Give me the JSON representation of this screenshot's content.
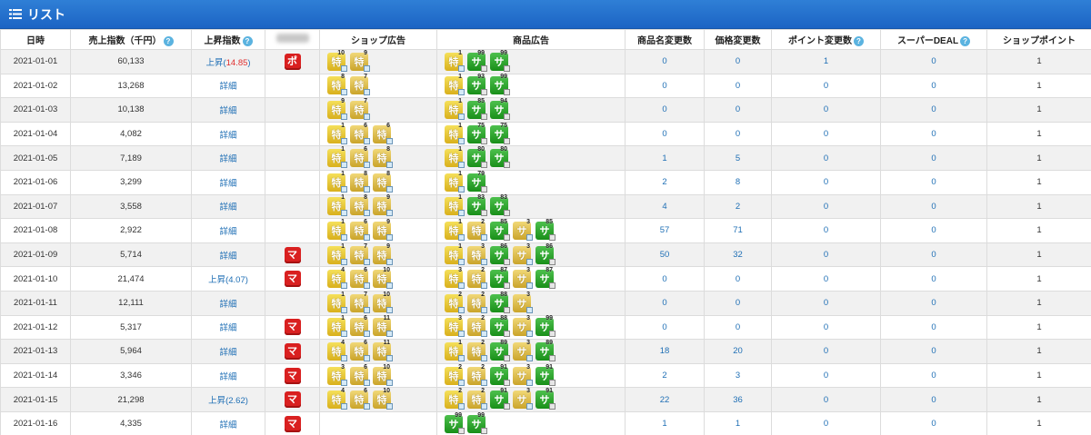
{
  "title": "リスト",
  "headers": {
    "date": "日時",
    "sales": "売上指数（千円）",
    "rise": "上昇指数",
    "shop_ad": "ショップ広告",
    "item_ad": "商品広告",
    "name_change": "商品名変更数",
    "price_change": "価格変更数",
    "point_change": "ポイント変更数",
    "super_deal": "スーパーDEAL",
    "shop_point": "ショップポイント"
  },
  "help_glyph": "?",
  "rows": [
    {
      "date": "2021-01-01",
      "sales": "60,133",
      "rise_prefix": "上昇(",
      "rise_value": "14.85",
      "rise_suffix": ")",
      "rise_type": "up-red",
      "badge": "ポ",
      "shop": [
        {
          "l": "特",
          "n": "10",
          "s": "y1"
        },
        {
          "l": "特",
          "n": "9",
          "s": "y2"
        }
      ],
      "item": [
        {
          "l": "特",
          "n": "1",
          "s": "y1"
        },
        {
          "l": "サ",
          "n": "99",
          "s": "g"
        },
        {
          "l": "サ",
          "n": "99",
          "s": "g"
        }
      ],
      "name": "0",
      "price": "0",
      "point": "1",
      "deal": "0",
      "sp": "1"
    },
    {
      "date": "2021-01-02",
      "sales": "13,268",
      "rise": "詳細",
      "badge": "",
      "shop": [
        {
          "l": "特",
          "n": "8",
          "s": "y1"
        },
        {
          "l": "特",
          "n": "7",
          "s": "y2"
        }
      ],
      "item": [
        {
          "l": "特",
          "n": "1",
          "s": "y1"
        },
        {
          "l": "サ",
          "n": "93",
          "s": "g"
        },
        {
          "l": "サ",
          "n": "99",
          "s": "g"
        }
      ],
      "name": "0",
      "price": "0",
      "point": "0",
      "deal": "0",
      "sp": "1"
    },
    {
      "date": "2021-01-03",
      "sales": "10,138",
      "rise": "詳細",
      "badge": "",
      "shop": [
        {
          "l": "特",
          "n": "9",
          "s": "y1"
        },
        {
          "l": "特",
          "n": "7",
          "s": "y2"
        }
      ],
      "item": [
        {
          "l": "特",
          "n": "1",
          "s": "y1"
        },
        {
          "l": "サ",
          "n": "85",
          "s": "g"
        },
        {
          "l": "サ",
          "n": "94",
          "s": "g"
        }
      ],
      "name": "0",
      "price": "0",
      "point": "0",
      "deal": "0",
      "sp": "1"
    },
    {
      "date": "2021-01-04",
      "sales": "4,082",
      "rise": "詳細",
      "badge": "",
      "shop": [
        {
          "l": "特",
          "n": "1",
          "s": "y1"
        },
        {
          "l": "特",
          "n": "6",
          "s": "y2"
        },
        {
          "l": "特",
          "n": "6",
          "s": "y2"
        }
      ],
      "item": [
        {
          "l": "特",
          "n": "1",
          "s": "y1"
        },
        {
          "l": "サ",
          "n": "75",
          "s": "g"
        },
        {
          "l": "サ",
          "n": "75",
          "s": "g"
        }
      ],
      "name": "0",
      "price": "0",
      "point": "0",
      "deal": "0",
      "sp": "1"
    },
    {
      "date": "2021-01-05",
      "sales": "7,189",
      "rise": "詳細",
      "badge": "",
      "shop": [
        {
          "l": "特",
          "n": "1",
          "s": "y1"
        },
        {
          "l": "特",
          "n": "6",
          "s": "y2"
        },
        {
          "l": "特",
          "n": "8",
          "s": "y2"
        }
      ],
      "item": [
        {
          "l": "特",
          "n": "1",
          "s": "y1"
        },
        {
          "l": "サ",
          "n": "80",
          "s": "g"
        },
        {
          "l": "サ",
          "n": "80",
          "s": "g"
        }
      ],
      "name": "1",
      "price": "5",
      "point": "0",
      "deal": "0",
      "sp": "1"
    },
    {
      "date": "2021-01-06",
      "sales": "3,299",
      "rise": "詳細",
      "badge": "",
      "shop": [
        {
          "l": "特",
          "n": "1",
          "s": "y1"
        },
        {
          "l": "特",
          "n": "8",
          "s": "y2"
        },
        {
          "l": "特",
          "n": "8",
          "s": "y2"
        }
      ],
      "item": [
        {
          "l": "特",
          "n": "1",
          "s": "y1"
        },
        {
          "l": "サ",
          "n": "79",
          "s": "g"
        }
      ],
      "name": "2",
      "price": "8",
      "point": "0",
      "deal": "0",
      "sp": "1"
    },
    {
      "date": "2021-01-07",
      "sales": "3,558",
      "rise": "詳細",
      "badge": "",
      "shop": [
        {
          "l": "特",
          "n": "1",
          "s": "y1"
        },
        {
          "l": "特",
          "n": "8",
          "s": "y2"
        },
        {
          "l": "特",
          "n": "9",
          "s": "y2"
        }
      ],
      "item": [
        {
          "l": "特",
          "n": "1",
          "s": "y1"
        },
        {
          "l": "サ",
          "n": "83",
          "s": "g"
        },
        {
          "l": "サ",
          "n": "83",
          "s": "g"
        }
      ],
      "name": "4",
      "price": "2",
      "point": "0",
      "deal": "0",
      "sp": "1"
    },
    {
      "date": "2021-01-08",
      "sales": "2,922",
      "rise": "詳細",
      "badge": "",
      "shop": [
        {
          "l": "特",
          "n": "1",
          "s": "y1"
        },
        {
          "l": "特",
          "n": "6",
          "s": "y2"
        },
        {
          "l": "特",
          "n": "9",
          "s": "y2"
        }
      ],
      "item": [
        {
          "l": "特",
          "n": "1",
          "s": "y1"
        },
        {
          "l": "特",
          "n": "2",
          "s": "y2"
        },
        {
          "l": "サ",
          "n": "85",
          "s": "g"
        },
        {
          "l": "サ",
          "n": "3",
          "s": "y2"
        },
        {
          "l": "サ",
          "n": "85",
          "s": "g"
        }
      ],
      "name": "57",
      "price": "71",
      "point": "0",
      "deal": "0",
      "sp": "1"
    },
    {
      "date": "2021-01-09",
      "sales": "5,714",
      "rise": "詳細",
      "badge": "マ",
      "shop": [
        {
          "l": "特",
          "n": "1",
          "s": "y1"
        },
        {
          "l": "特",
          "n": "7",
          "s": "y2"
        },
        {
          "l": "特",
          "n": "9",
          "s": "y2"
        }
      ],
      "item": [
        {
          "l": "特",
          "n": "1",
          "s": "y1"
        },
        {
          "l": "特",
          "n": "3",
          "s": "y2"
        },
        {
          "l": "サ",
          "n": "86",
          "s": "g"
        },
        {
          "l": "サ",
          "n": "3",
          "s": "y2"
        },
        {
          "l": "サ",
          "n": "86",
          "s": "g"
        }
      ],
      "name": "50",
      "price": "32",
      "point": "0",
      "deal": "0",
      "sp": "1"
    },
    {
      "date": "2021-01-10",
      "sales": "21,474",
      "rise_prefix": "上昇(",
      "rise_value": "4.07",
      "rise_suffix": ")",
      "rise_type": "up-blue",
      "badge": "マ",
      "shop": [
        {
          "l": "特",
          "n": "4",
          "s": "y1"
        },
        {
          "l": "特",
          "n": "6",
          "s": "y2"
        },
        {
          "l": "特",
          "n": "10",
          "s": "y2"
        }
      ],
      "item": [
        {
          "l": "特",
          "n": "3",
          "s": "y1"
        },
        {
          "l": "特",
          "n": "2",
          "s": "y2"
        },
        {
          "l": "サ",
          "n": "87",
          "s": "g"
        },
        {
          "l": "サ",
          "n": "3",
          "s": "y2"
        },
        {
          "l": "サ",
          "n": "87",
          "s": "g"
        }
      ],
      "name": "0",
      "price": "0",
      "point": "0",
      "deal": "0",
      "sp": "1"
    },
    {
      "date": "2021-01-11",
      "sales": "12,111",
      "rise": "詳細",
      "badge": "",
      "shop": [
        {
          "l": "特",
          "n": "1",
          "s": "y1"
        },
        {
          "l": "特",
          "n": "7",
          "s": "y2"
        },
        {
          "l": "特",
          "n": "10",
          "s": "y2"
        }
      ],
      "item": [
        {
          "l": "特",
          "n": "2",
          "s": "y1"
        },
        {
          "l": "特",
          "n": "2",
          "s": "y2"
        },
        {
          "l": "サ",
          "n": "88",
          "s": "g"
        },
        {
          "l": "サ",
          "n": "3",
          "s": "y2"
        }
      ],
      "name": "0",
      "price": "0",
      "point": "0",
      "deal": "0",
      "sp": "1"
    },
    {
      "date": "2021-01-12",
      "sales": "5,317",
      "rise": "詳細",
      "badge": "マ",
      "shop": [
        {
          "l": "特",
          "n": "1",
          "s": "y1"
        },
        {
          "l": "特",
          "n": "6",
          "s": "y2"
        },
        {
          "l": "特",
          "n": "11",
          "s": "y2"
        }
      ],
      "item": [
        {
          "l": "特",
          "n": "3",
          "s": "y1"
        },
        {
          "l": "特",
          "n": "2",
          "s": "y2"
        },
        {
          "l": "サ",
          "n": "88",
          "s": "g"
        },
        {
          "l": "サ",
          "n": "3",
          "s": "y2"
        },
        {
          "l": "サ",
          "n": "99",
          "s": "g"
        }
      ],
      "name": "0",
      "price": "0",
      "point": "0",
      "deal": "0",
      "sp": "1"
    },
    {
      "date": "2021-01-13",
      "sales": "5,964",
      "rise": "詳細",
      "badge": "マ",
      "shop": [
        {
          "l": "特",
          "n": "4",
          "s": "y1"
        },
        {
          "l": "特",
          "n": "6",
          "s": "y2"
        },
        {
          "l": "特",
          "n": "11",
          "s": "y2"
        }
      ],
      "item": [
        {
          "l": "特",
          "n": "1",
          "s": "y1"
        },
        {
          "l": "特",
          "n": "2",
          "s": "y2"
        },
        {
          "l": "サ",
          "n": "89",
          "s": "g"
        },
        {
          "l": "サ",
          "n": "3",
          "s": "y2"
        },
        {
          "l": "サ",
          "n": "89",
          "s": "g"
        }
      ],
      "name": "18",
      "price": "20",
      "point": "0",
      "deal": "0",
      "sp": "1"
    },
    {
      "date": "2021-01-14",
      "sales": "3,346",
      "rise": "詳細",
      "badge": "マ",
      "shop": [
        {
          "l": "特",
          "n": "3",
          "s": "y1"
        },
        {
          "l": "特",
          "n": "6",
          "s": "y2"
        },
        {
          "l": "特",
          "n": "10",
          "s": "y2"
        }
      ],
      "item": [
        {
          "l": "特",
          "n": "2",
          "s": "y1"
        },
        {
          "l": "特",
          "n": "2",
          "s": "y2"
        },
        {
          "l": "サ",
          "n": "91",
          "s": "g"
        },
        {
          "l": "サ",
          "n": "3",
          "s": "y2"
        },
        {
          "l": "サ",
          "n": "91",
          "s": "g"
        }
      ],
      "name": "2",
      "price": "3",
      "point": "0",
      "deal": "0",
      "sp": "1"
    },
    {
      "date": "2021-01-15",
      "sales": "21,298",
      "rise_prefix": "上昇(",
      "rise_value": "2.62",
      "rise_suffix": ")",
      "rise_type": "up-blue",
      "badge": "マ",
      "shop": [
        {
          "l": "特",
          "n": "4",
          "s": "y1"
        },
        {
          "l": "特",
          "n": "6",
          "s": "y2"
        },
        {
          "l": "特",
          "n": "10",
          "s": "y2"
        }
      ],
      "item": [
        {
          "l": "特",
          "n": "2",
          "s": "y1"
        },
        {
          "l": "特",
          "n": "2",
          "s": "y2"
        },
        {
          "l": "サ",
          "n": "91",
          "s": "g"
        },
        {
          "l": "サ",
          "n": "3",
          "s": "y2"
        },
        {
          "l": "サ",
          "n": "91",
          "s": "g"
        }
      ],
      "name": "22",
      "price": "36",
      "point": "0",
      "deal": "0",
      "sp": "1"
    },
    {
      "date": "2021-01-16",
      "sales": "4,335",
      "rise": "詳細",
      "badge": "マ",
      "shop": [],
      "item": [
        {
          "l": "サ",
          "n": "99",
          "s": "g"
        },
        {
          "l": "サ",
          "n": "99",
          "s": "g"
        }
      ],
      "name": "1",
      "price": "1",
      "point": "0",
      "deal": "0",
      "sp": "1"
    }
  ]
}
